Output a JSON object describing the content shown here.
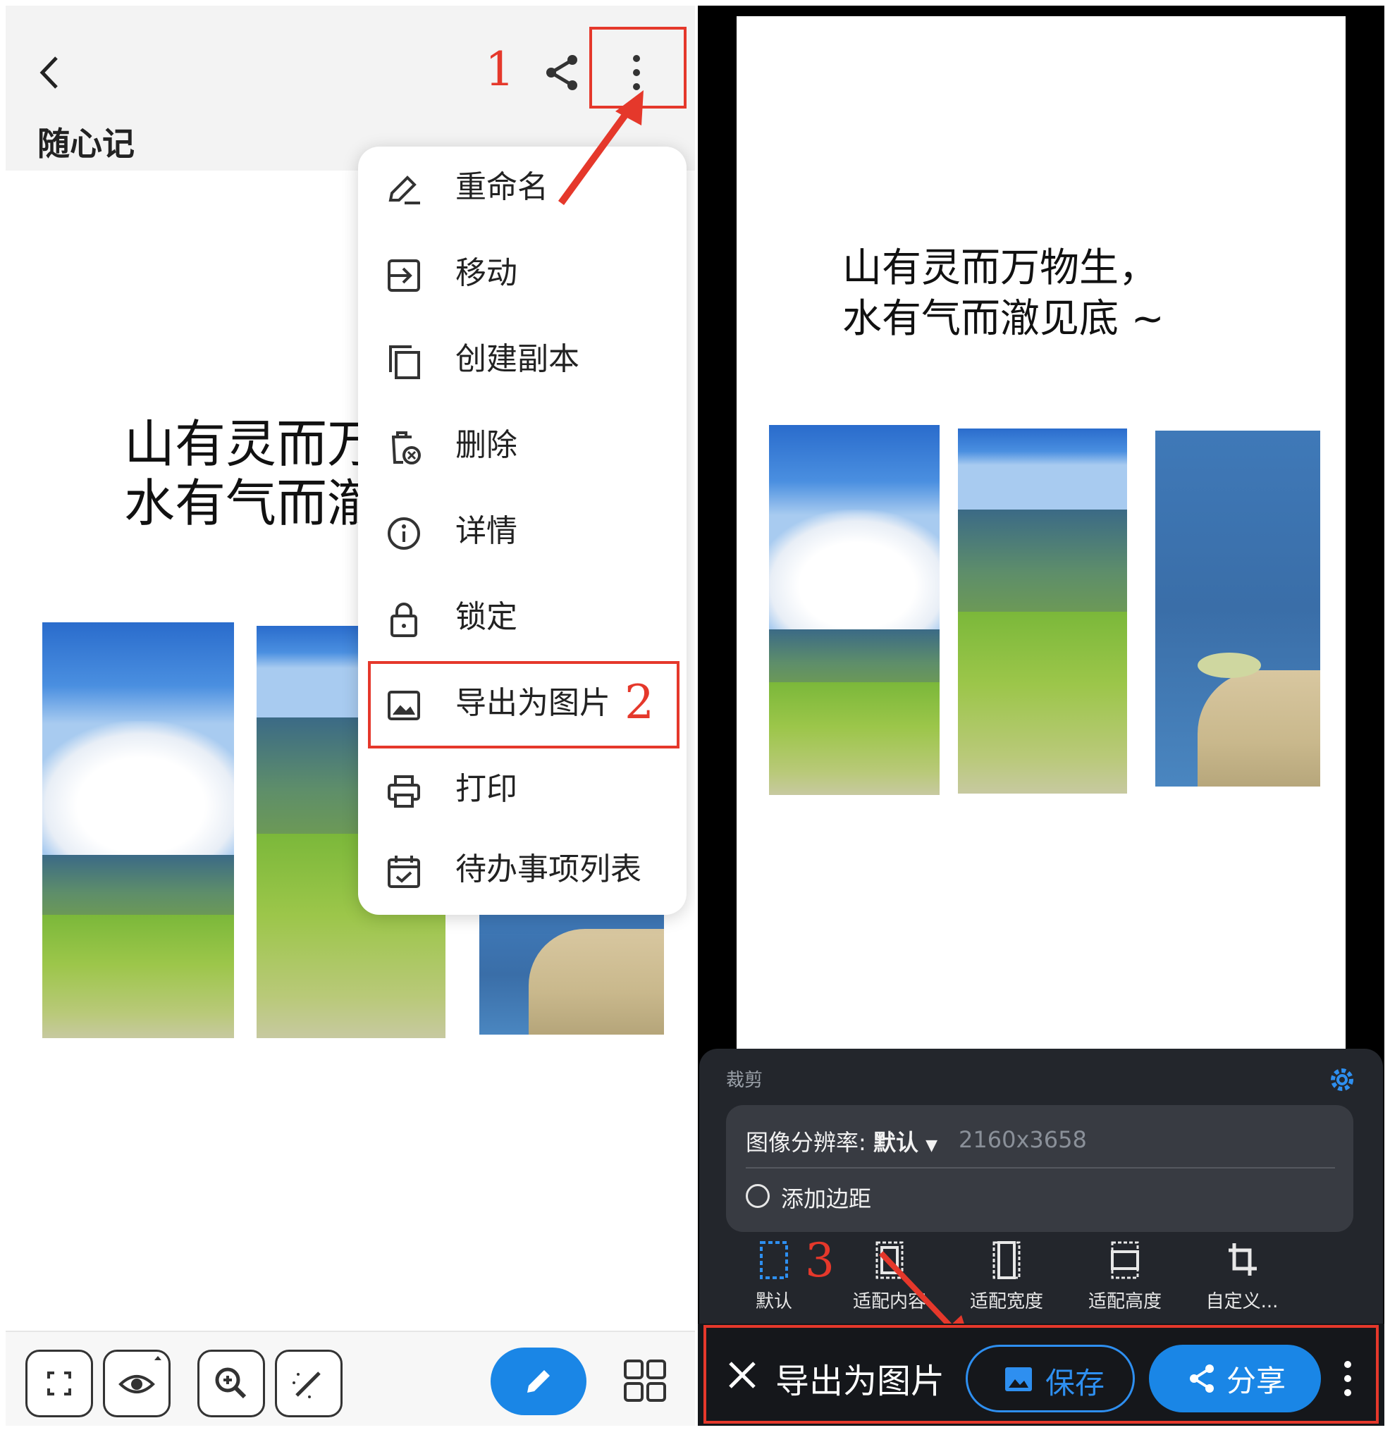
{
  "left": {
    "header": {
      "title": "随心记"
    },
    "step_labels": {
      "one": "1",
      "two": "2"
    },
    "poem": {
      "line1": "山有灵而万",
      "line2": "水有气而澈"
    },
    "menu": {
      "items": [
        {
          "label": "重命名",
          "icon": "rename-pen-icon"
        },
        {
          "label": "移动",
          "icon": "move-icon"
        },
        {
          "label": "创建副本",
          "icon": "copy-icon"
        },
        {
          "label": "删除",
          "icon": "delete-icon"
        },
        {
          "label": "详情",
          "icon": "info-icon"
        },
        {
          "label": "锁定",
          "icon": "lock-icon"
        },
        {
          "label": "导出为图片",
          "icon": "image-icon"
        },
        {
          "label": "打印",
          "icon": "printer-icon"
        },
        {
          "label": "待办事项列表",
          "icon": "todo-calendar-icon"
        }
      ]
    }
  },
  "right": {
    "poem": {
      "line1": "山有灵而万物生，",
      "line2": "水有气而澈见底 ~"
    },
    "sheet": {
      "section_label": "裁剪",
      "resolution_label": "图像分辨率: ",
      "resolution_value": "默认",
      "resolution_dims": "2160x3658",
      "add_margin_label": "添加边距",
      "crop_options": [
        {
          "label": "默认",
          "selected": true
        },
        {
          "label": "适配内容"
        },
        {
          "label": "适配宽度"
        },
        {
          "label": "适配高度"
        },
        {
          "label": "自定义..."
        }
      ],
      "step_label": "3"
    },
    "bottom": {
      "title": "导出为图片",
      "save_label": "保存",
      "share_label": "分享"
    }
  },
  "colors": {
    "accent": "#1a86e6",
    "annotation_red": "#e5382b",
    "sheet_bg": "#23262c"
  }
}
